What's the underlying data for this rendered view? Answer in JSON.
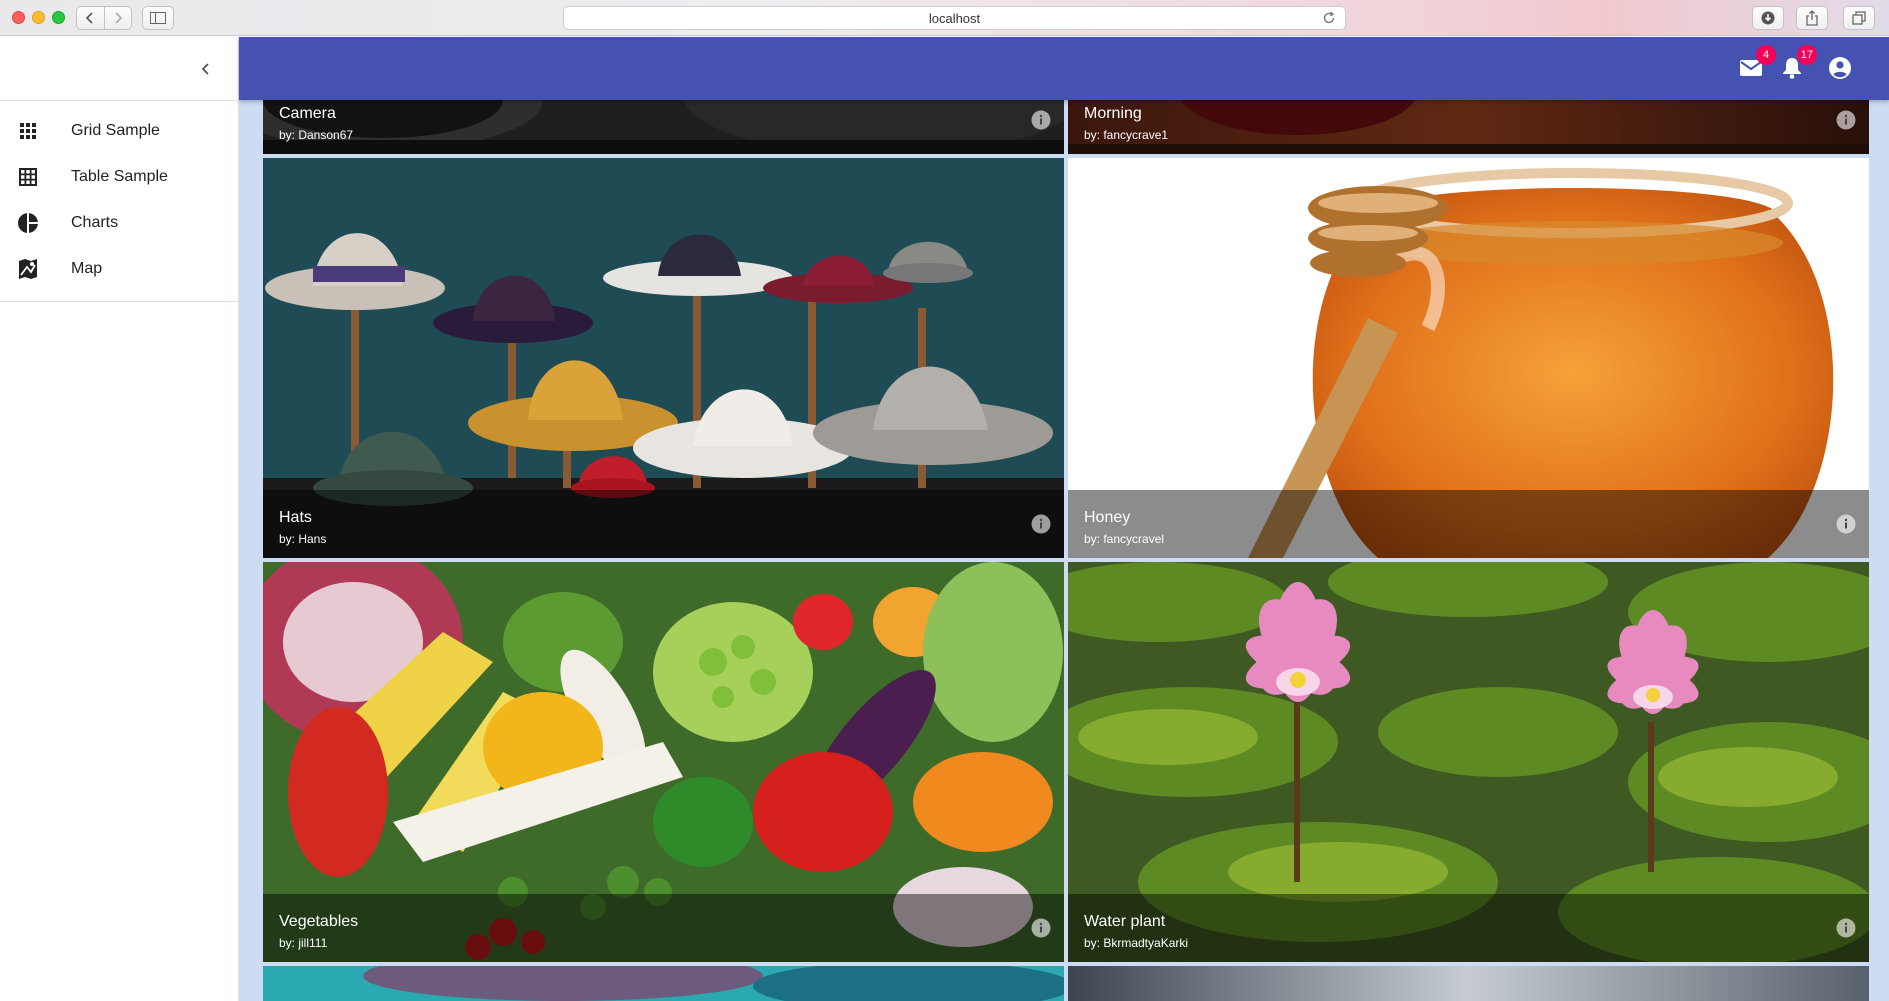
{
  "browser": {
    "url": "localhost"
  },
  "sidebar": {
    "items": [
      {
        "label": "Grid Sample",
        "icon": "apps-icon"
      },
      {
        "label": "Table Sample",
        "icon": "grid-on-icon"
      },
      {
        "label": "Charts",
        "icon": "pie-chart-icon"
      },
      {
        "label": "Map",
        "icon": "map-icon"
      }
    ]
  },
  "appbar": {
    "color": "#4552b1",
    "mail_badge": "4",
    "notifications_badge": "17",
    "badge_color": "#f50057"
  },
  "tiles": [
    {
      "title": "Camera",
      "author": "by: Danson67"
    },
    {
      "title": "Morning",
      "author": "by: fancycrave1"
    },
    {
      "title": "Hats",
      "author": "by: Hans"
    },
    {
      "title": "Honey",
      "author": "by: fancycravel"
    },
    {
      "title": "Vegetables",
      "author": "by: jill111"
    },
    {
      "title": "Water plant",
      "author": "by: BkrmadtyaKarki"
    }
  ]
}
